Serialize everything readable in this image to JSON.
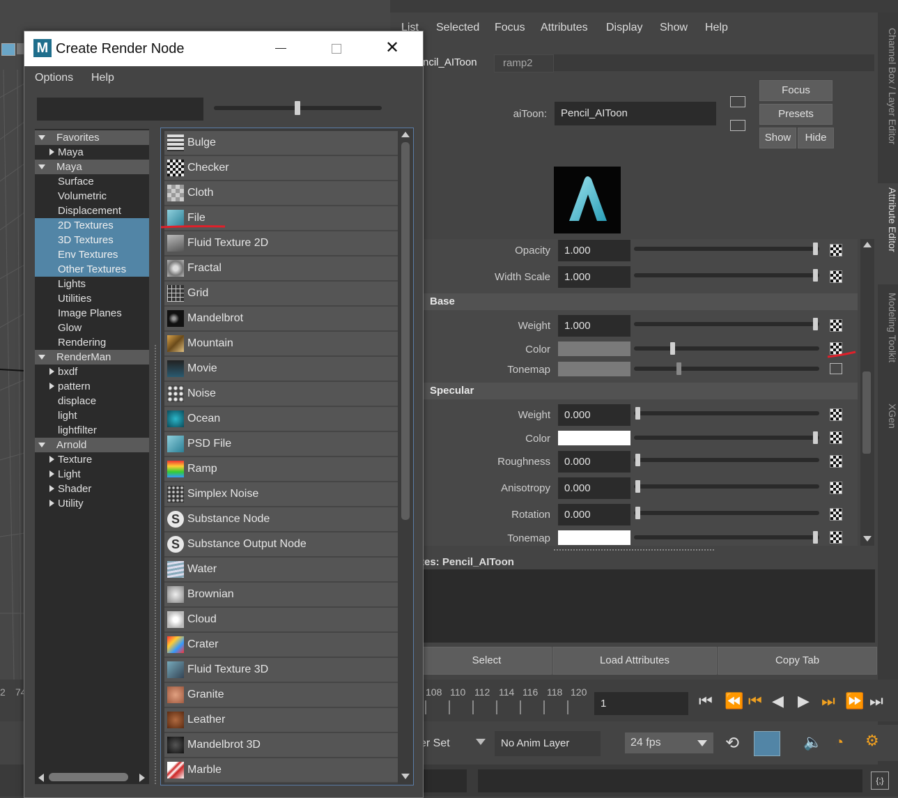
{
  "attribute_editor": {
    "menu": [
      "List",
      "Selected",
      "Focus",
      "Attributes",
      "Display",
      "Show",
      "Help"
    ],
    "tabs": [
      "ncil_AIToon",
      "ramp2"
    ],
    "node_type_label": "aiToon:",
    "node_name": "Pencil_AIToon",
    "buttons": {
      "focus": "Focus",
      "presets": "Presets",
      "show": "Show",
      "hide": "Hide"
    },
    "sections": {
      "base": "Base",
      "specular": "Specular"
    },
    "rows": {
      "opacity": {
        "label": "Opacity",
        "value": "1.000"
      },
      "width_scale": {
        "label": "Width Scale",
        "value": "1.000"
      },
      "base_weight": {
        "label": "Weight",
        "value": "1.000"
      },
      "base_color": {
        "label": "Color"
      },
      "base_tonemap": {
        "label": "Tonemap"
      },
      "spec_weight": {
        "label": "Weight",
        "value": "0.000"
      },
      "spec_color": {
        "label": "Color"
      },
      "roughness": {
        "label": "Roughness",
        "value": "0.000"
      },
      "anisotropy": {
        "label": "Anisotropy",
        "value": "0.000"
      },
      "rotation": {
        "label": "Rotation",
        "value": "0.000"
      },
      "spec_tonemap": {
        "label": "Tonemap"
      }
    },
    "notes_label": "tes:  Pencil_AIToon",
    "bottom_buttons": {
      "select": "Select",
      "load": "Load Attributes",
      "copy": "Copy Tab"
    }
  },
  "side_tabs": [
    "Channel Box / Layer Editor",
    "Attribute Editor",
    "Modeling Toolkit",
    "XGen"
  ],
  "timeline": {
    "ticks": [
      "108",
      "110",
      "112",
      "114",
      "116",
      "118",
      "120"
    ],
    "left_ticks": [
      "2",
      "74"
    ],
    "current_frame": "1"
  },
  "anim_bar": {
    "char_set": "er Set",
    "anim_layer": "No Anim Layer",
    "fps": "24 fps"
  },
  "dialog": {
    "title": "Create Render Node",
    "menu": [
      "Options",
      "Help"
    ],
    "search_value": "",
    "tree": [
      {
        "label": "Favorites",
        "kind": "hdr"
      },
      {
        "label": "Maya",
        "kind": "collapsed"
      },
      {
        "label": "Maya",
        "kind": "hdr"
      },
      {
        "label": "Surface",
        "kind": "leaf"
      },
      {
        "label": "Volumetric",
        "kind": "leaf"
      },
      {
        "label": "Displacement",
        "kind": "leaf"
      },
      {
        "label": "2D Textures",
        "kind": "sel"
      },
      {
        "label": "3D Textures",
        "kind": "sel"
      },
      {
        "label": "Env Textures",
        "kind": "sel"
      },
      {
        "label": "Other Textures",
        "kind": "sel"
      },
      {
        "label": "Lights",
        "kind": "leaf"
      },
      {
        "label": "Utilities",
        "kind": "leaf"
      },
      {
        "label": "Image Planes",
        "kind": "leaf"
      },
      {
        "label": "Glow",
        "kind": "leaf"
      },
      {
        "label": "Rendering",
        "kind": "leaf"
      },
      {
        "label": "RenderMan",
        "kind": "hdr"
      },
      {
        "label": "bxdf",
        "kind": "collapsed"
      },
      {
        "label": "pattern",
        "kind": "collapsed"
      },
      {
        "label": "displace",
        "kind": "leaf"
      },
      {
        "label": "light",
        "kind": "leaf"
      },
      {
        "label": "lightfilter",
        "kind": "leaf"
      },
      {
        "label": "Arnold",
        "kind": "hdr"
      },
      {
        "label": "Texture",
        "kind": "collapsed"
      },
      {
        "label": "Light",
        "kind": "collapsed"
      },
      {
        "label": "Shader",
        "kind": "collapsed"
      },
      {
        "label": "Utility",
        "kind": "collapsed"
      }
    ],
    "nodes": [
      {
        "label": "Bulge",
        "icon": "bulge-icon"
      },
      {
        "label": "Checker",
        "icon": "checker-icon"
      },
      {
        "label": "Cloth",
        "icon": "cloth-icon"
      },
      {
        "label": "File",
        "icon": "file-icon"
      },
      {
        "label": "Fluid Texture 2D",
        "icon": "fluid-texture-2d-icon"
      },
      {
        "label": "Fractal",
        "icon": "fractal-icon"
      },
      {
        "label": "Grid",
        "icon": "grid-icon"
      },
      {
        "label": "Mandelbrot",
        "icon": "mandelbrot-icon"
      },
      {
        "label": "Mountain",
        "icon": "mountain-icon"
      },
      {
        "label": "Movie",
        "icon": "movie-icon"
      },
      {
        "label": "Noise",
        "icon": "noise-icon"
      },
      {
        "label": "Ocean",
        "icon": "ocean-icon"
      },
      {
        "label": "PSD File",
        "icon": "psd-file-icon"
      },
      {
        "label": "Ramp",
        "icon": "ramp-icon"
      },
      {
        "label": "Simplex Noise",
        "icon": "simplex-noise-icon"
      },
      {
        "label": "Substance Node",
        "icon": "substance-icon"
      },
      {
        "label": "Substance Output Node",
        "icon": "substance-output-icon"
      },
      {
        "label": "Water",
        "icon": "water-icon"
      },
      {
        "label": "Brownian",
        "icon": "brownian-icon"
      },
      {
        "label": "Cloud",
        "icon": "cloud-icon"
      },
      {
        "label": "Crater",
        "icon": "crater-icon"
      },
      {
        "label": "Fluid Texture 3D",
        "icon": "fluid-texture-3d-icon"
      },
      {
        "label": "Granite",
        "icon": "granite-icon"
      },
      {
        "label": "Leather",
        "icon": "leather-icon"
      },
      {
        "label": "Mandelbrot 3D",
        "icon": "mandelbrot-3d-icon"
      },
      {
        "label": "Marble",
        "icon": "marble-icon"
      }
    ]
  },
  "colors": {
    "selection": "#5285a6",
    "annotation": "#e0202a",
    "panel": "#444444"
  }
}
